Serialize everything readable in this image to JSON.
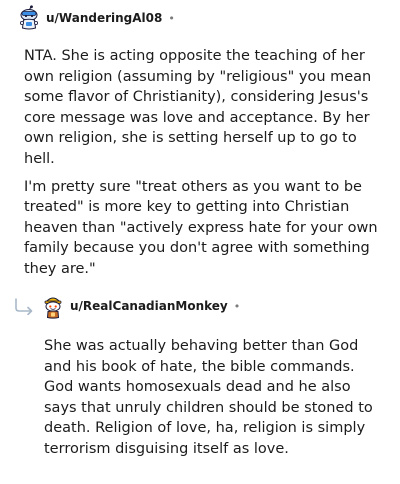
{
  "comments": [
    {
      "username": "u/WanderingAl08",
      "separator": "•",
      "paragraphs": [
        "NTA. She is acting opposite the teaching of her own religion (assuming by \"religious\" you mean some flavor of Christianity), considering Jesus's core message was love and acceptance. By her own religion, she is setting herself up to go to hell.",
        "I'm pretty sure \"treat others as you want to be treated\" is more key to getting into Christian heaven than \"actively express hate for your own family because you don't agree with something they are.\""
      ]
    },
    {
      "username": "u/RealCanadianMonkey",
      "separator": "•",
      "paragraphs": [
        "She was actually behaving better than God and his book of hate, the bible commands. God wants homosexuals dead and he also says that unruly children should be stoned to death. Religion of love, ha, religion is simply terrorism disguising itself as love."
      ]
    }
  ],
  "icons": {
    "avatar_1": "snoo-avatar-blue-helmet",
    "avatar_2": "snoo-avatar-orange-hat",
    "reply": "reply-arrow-icon"
  }
}
